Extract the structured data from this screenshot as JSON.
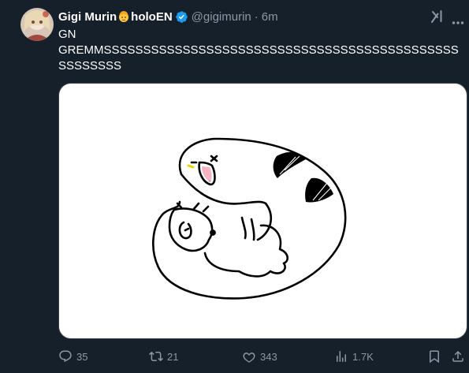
{
  "tweet": {
    "display_name": "Gigi Murin",
    "display_name_suffix": "holoEN",
    "handle": "@gigimurin",
    "separator": "·",
    "time": "6m",
    "text_line1": "GN",
    "text_line2": "GREMMSSSSSSSSSSSSSSSSSSSSSSSSSSSSSSSSSSSSSSSSSSSSSSSSSSSSS",
    "icons": {
      "name_emoji": "blonde-person-emoji-icon",
      "verified": "verified-badge-icon",
      "grok": "grok-icon",
      "more": "more-icon"
    }
  },
  "actions": {
    "reply_count": "35",
    "retweet_count": "21",
    "like_count": "343",
    "view_count": "1.7K"
  },
  "colors": {
    "background": "#15202b",
    "text_primary": "#ffffff",
    "text_secondary": "#8b98a5",
    "verified_blue": "#1d9bf0",
    "media_background": "#ffffff"
  }
}
